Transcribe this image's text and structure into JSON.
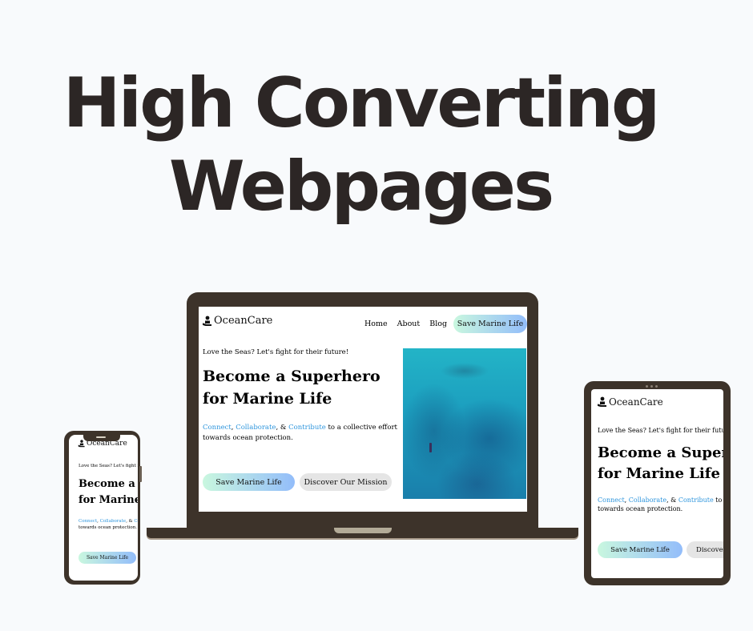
{
  "headline": {
    "line1": "High Converting",
    "line2": "Webpages"
  },
  "site": {
    "brand": "OceanCare",
    "logo_icon": "person-with-hand-icon",
    "nav": [
      "Home",
      "About",
      "Blog"
    ],
    "nav_cta": "Save Marine Life",
    "tagline": "Love the Seas? Let's fight for their future!",
    "hero_line1": "Become a Superhero",
    "hero_line2": "for Marine Life",
    "desc": {
      "connect": "Connect",
      "sep1": ", ",
      "collaborate": "Collaborate",
      "sep2": ", & ",
      "contribute": "Contribute",
      "rest1": " to a collective effort",
      "rest2": "towards ocean protection."
    },
    "primary_button": "Save Marine Life",
    "secondary_button": "Discover Our Mission",
    "image_alt": "aerial ocean view with diver"
  },
  "tablet": {
    "tagline": "Love the Seas? Let's fight for their future!",
    "hero_line1": "Become a Superhero",
    "hero_line2": "for Marine Life",
    "primary_button": "Save Marine Life",
    "secondary_button": "Discover Our Mission"
  },
  "colors": {
    "frame": "#3d332a",
    "headline": "#2c2625",
    "accent_link": "#2f96dd",
    "bg": "#f8fafc"
  }
}
